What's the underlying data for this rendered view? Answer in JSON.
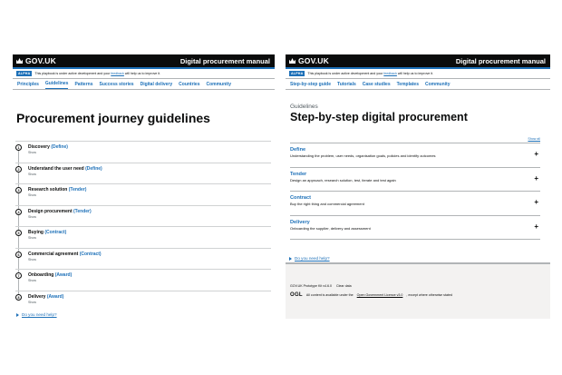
{
  "left": {
    "header": {
      "logo": "GOV.UK",
      "service": "Digital procurement manual"
    },
    "phase": {
      "tag": "ALPHA",
      "before": "This playbook is under active development and your ",
      "link": "feedback",
      "after": " will help us to improve it."
    },
    "nav": [
      "Principles",
      "Guidelines",
      "Patterns",
      "Success stories",
      "Digital delivery",
      "Countries",
      "Community"
    ],
    "nav_active_index": 1,
    "title": "Procurement journey guidelines",
    "steps": [
      {
        "num": "1",
        "title": "Discovery",
        "meta": "(Define)",
        "show": "Show"
      },
      {
        "num": "2",
        "title": "Understand the user need",
        "meta": "(Define)",
        "show": "Show"
      },
      {
        "num": "3",
        "title": "Research solution",
        "meta": "(Tender)",
        "show": "Show"
      },
      {
        "num": "4",
        "title": "Design procurement",
        "meta": "(Tender)",
        "show": "Show"
      },
      {
        "num": "5",
        "title": "Buying",
        "meta": "(Contract)",
        "show": "Show"
      },
      {
        "num": "6",
        "title": "Commercial agreement",
        "meta": "(Contract)",
        "show": "Show"
      },
      {
        "num": "7",
        "title": "Onboarding",
        "meta": "(Award)",
        "show": "Show"
      },
      {
        "num": "8",
        "title": "Delivery",
        "meta": "(Award)",
        "show": "Show"
      }
    ],
    "help": "Do you need help?"
  },
  "right": {
    "header": {
      "logo": "GOV.UK",
      "service": "Digital procurement manual"
    },
    "phase": {
      "tag": "ALPHA",
      "before": "This playbook is under active development and your ",
      "link": "feedback",
      "after": " will help us to improve it."
    },
    "nav": [
      "Step-by-step guide",
      "Tutorials",
      "Case studies",
      "Templates",
      "Community"
    ],
    "caption": "Guidelines",
    "title": "Step-by-step digital procurement",
    "show_all": "Show all",
    "sections": [
      {
        "title": "Define",
        "summary": "Understanding the problem, user needs, organisation goals, policies and identify outcomes",
        "icon": "+"
      },
      {
        "title": "Tender",
        "summary": "Design an approach, research solution, test, iterate and test again",
        "icon": "+"
      },
      {
        "title": "Contract",
        "summary": "Buy the right thing and commercial agreement",
        "icon": "+"
      },
      {
        "title": "Delivery",
        "summary": "Onboarding the supplier, delivery and assessment",
        "icon": "+"
      }
    ],
    "help": "Do you need help?",
    "footer": {
      "links": [
        "GOV.UK Prototype Kit v4.6.0",
        "Clear data"
      ],
      "licence_logo": "OGL",
      "licence_before": "All content is available under the ",
      "licence_link": "Open Government Licence v3.0",
      "licence_after": ", except where otherwise stated"
    }
  }
}
